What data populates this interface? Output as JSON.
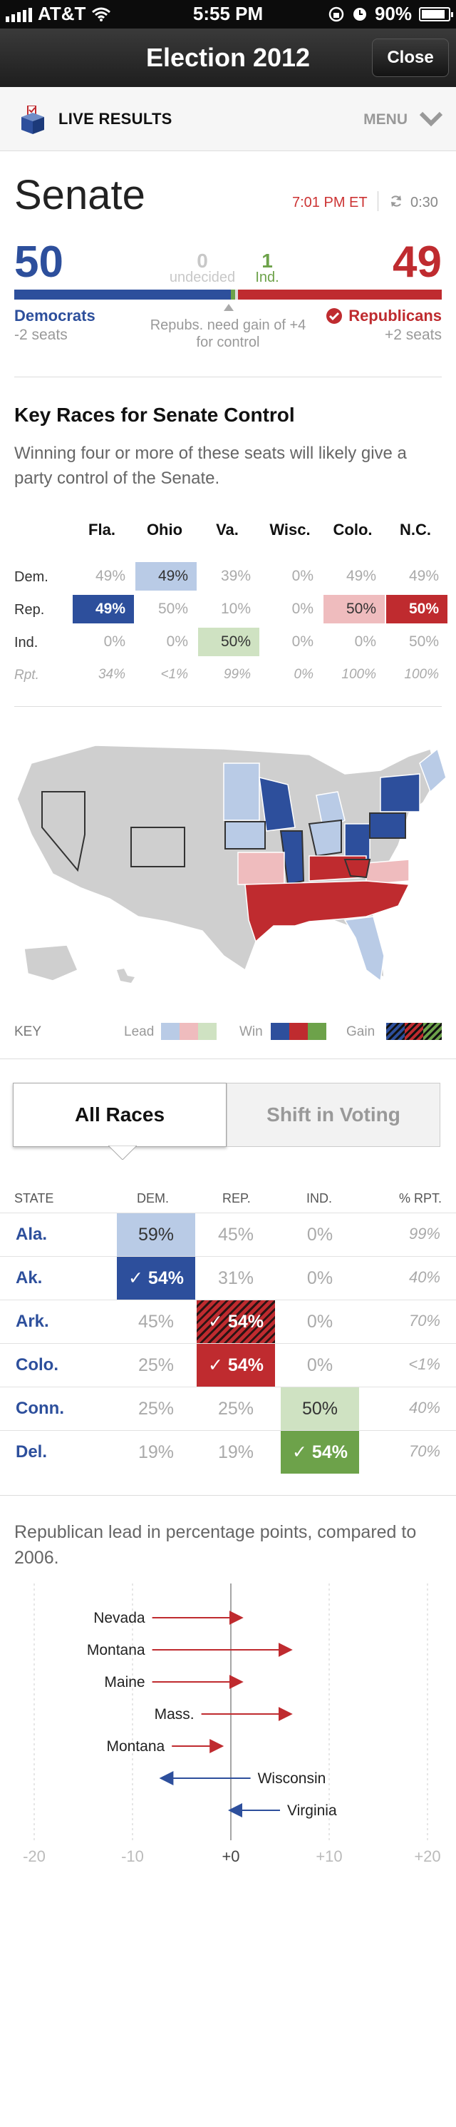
{
  "status_bar": {
    "carrier": "AT&T",
    "time": "5:55 PM",
    "battery": "90%",
    "battery_level": 0.9
  },
  "nav": {
    "title": "Election 2012",
    "close_label": "Close"
  },
  "live_bar": {
    "label": "LIVE RESULTS",
    "menu_label": "MENU"
  },
  "senate": {
    "title": "Senate",
    "update_time": "7:01 PM ET",
    "countdown": "0:30",
    "dem_seats": "50",
    "rep_seats": "49",
    "undecided_count": "0",
    "undecided_label": "undecided",
    "ind_count": "1",
    "ind_label": "Ind.",
    "dem_label": "Democrats",
    "dem_change": "-2 seats",
    "rep_label": "Republicans",
    "rep_change": "+2 seats",
    "control_note": "Repubs. need gain of +4 for control",
    "colors": {
      "dem": "#2d4f9c",
      "rep": "#bf2b2f",
      "ind": "#6da24a"
    }
  },
  "key_races": {
    "title": "Key Races for Senate Control",
    "description": "Winning four or more of these seats will likely give a party control of the Senate.",
    "columns": [
      "Fla.",
      "Ohio",
      "Va.",
      "Wisc.",
      "Colo.",
      "N.C."
    ],
    "rows": [
      {
        "label": "Dem.",
        "values": [
          "49%",
          "49%",
          "39%",
          "0%",
          "49%",
          "49%"
        ]
      },
      {
        "label": "Rep.",
        "values": [
          "49%",
          "50%",
          "10%",
          "0%",
          "50%",
          "50%"
        ]
      },
      {
        "label": "Ind.",
        "values": [
          "0%",
          "0%",
          "50%",
          "0%",
          "0%",
          "50%"
        ]
      },
      {
        "label": "Rpt.",
        "values": [
          "34%",
          "<1%",
          "99%",
          "0%",
          "100%",
          "100%"
        ]
      }
    ]
  },
  "map_key": {
    "label": "KEY",
    "lead": "Lead",
    "win": "Win",
    "gain": "Gain"
  },
  "tabs": {
    "all_races": "All Races",
    "shift": "Shift in Voting"
  },
  "all_races": {
    "headers": [
      "STATE",
      "DEM.",
      "REP.",
      "IND.",
      "% RPT."
    ],
    "rows": [
      {
        "state": "Ala.",
        "dem": "59%",
        "rep": "45%",
        "ind": "0%",
        "rpt": "99%"
      },
      {
        "state": "Ak.",
        "dem": "✓ 54%",
        "rep": "31%",
        "ind": "0%",
        "rpt": "40%"
      },
      {
        "state": "Ark.",
        "dem": "45%",
        "rep": "✓ 54%",
        "ind": "0%",
        "rpt": "70%"
      },
      {
        "state": "Colo.",
        "dem": "25%",
        "rep": "✓ 54%",
        "ind": "0%",
        "rpt": "<1%"
      },
      {
        "state": "Conn.",
        "dem": "25%",
        "rep": "25%",
        "ind": "50%",
        "rpt": "40%"
      },
      {
        "state": "Del.",
        "dem": "19%",
        "rep": "19%",
        "ind": "✓ 54%",
        "rpt": "70%"
      }
    ]
  },
  "shift": {
    "description": "Republican lead in percentage points, compared to 2006."
  },
  "chart_data": {
    "type": "scatter",
    "title": "",
    "xlabel": "",
    "ylabel": "",
    "xlim": [
      -20,
      20
    ],
    "x_ticks": [
      "-20",
      "-10",
      "+0",
      "+10",
      "+20"
    ],
    "series": [
      {
        "name": "Nevada",
        "from": -8,
        "to": 1,
        "color": "#bf2b2f"
      },
      {
        "name": "Montana",
        "from": -8,
        "to": 6,
        "color": "#bf2b2f"
      },
      {
        "name": "Maine",
        "from": -8,
        "to": 1,
        "color": "#bf2b2f"
      },
      {
        "name": "Mass.",
        "from": -3,
        "to": 6,
        "color": "#bf2b2f"
      },
      {
        "name": "Montana",
        "from": -6,
        "to": -1,
        "color": "#bf2b2f"
      },
      {
        "name": "Wisconsin",
        "from": 2,
        "to": -7,
        "color": "#2d4f9c"
      },
      {
        "name": "Virginia",
        "from": 5,
        "to": 0,
        "color": "#2d4f9c"
      }
    ]
  }
}
